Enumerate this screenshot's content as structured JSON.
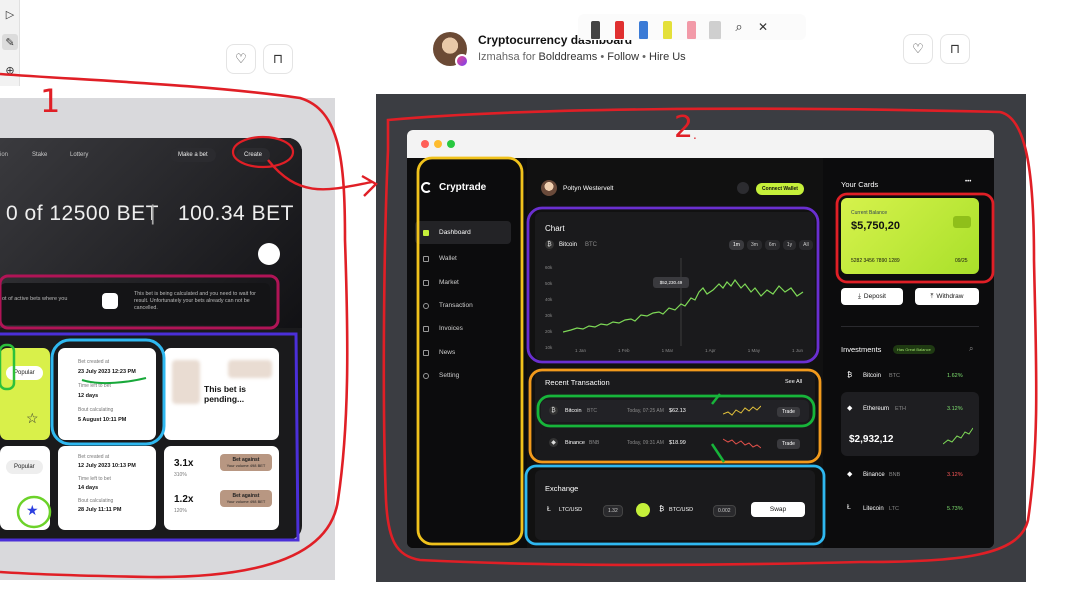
{
  "tools": {
    "select_icon": "▷",
    "pen_icon": "✎",
    "add_icon": "⊕"
  },
  "header": {
    "title": "Cryptocurrency dashboard",
    "author": "Izmahsa",
    "for_label": "for",
    "team": "Bolddreams",
    "follow_label": "Follow",
    "hire_label": "Hire Us",
    "separator": "•",
    "like_icon": "♡",
    "save_icon": "⊓"
  },
  "annotation_toolbar": {
    "pens": [
      "#444444",
      "#e03030",
      "#3b7bd6",
      "#e4e03a",
      "#f29aa8"
    ],
    "lasso_icon": "⌕",
    "close_icon": "✕"
  },
  "annotations": {
    "label_1": "1",
    "label_2": "2",
    "label_2_dot": "."
  },
  "shot1": {
    "nav": [
      "Stake",
      "Lottery"
    ],
    "nav_left_partial": "ion",
    "make_bet": "Make a bet",
    "create": "Create",
    "bet_total": "0 of 12500 BET",
    "divider": "|",
    "bet_value": "100.34 BET",
    "info_left": "ot of active bets where you",
    "info_right": "This bet is being calculated and you need to wait for result. Unfortunately your bets already can not be cancelled.",
    "popular": "Popular",
    "card1": {
      "created_label": "Bet created at",
      "created": "23 July 2023 12:23 PM",
      "time_left_label": "Time left to bet",
      "time_left": "12 days",
      "calc_label": "Bout calculating",
      "calc": "5 August 10:11 PM"
    },
    "pending": "This bet is pending...",
    "card2": {
      "created_label": "Bet created at",
      "created": "12 July 2023 10:13 PM",
      "time_left_label": "Time left to bet",
      "time_left": "14 days",
      "calc_label": "Bout calculating",
      "calc": "28 July 11:11 PM"
    },
    "mult1": "3.1x",
    "mult1_pct": "310%",
    "mult2": "1.2x",
    "mult2_pct": "120%",
    "bet_against": "Bet against",
    "bet_against_sub": "Your volume 498 BET",
    "star_icon": "☆",
    "star_filled_icon": "★"
  },
  "app": {
    "brand": "Cryptrade",
    "menu": [
      "Dashboard",
      "Wallet",
      "Market",
      "Transaction",
      "Invoices",
      "News",
      "Setting"
    ],
    "user": "Poltyn Westervelt",
    "connect_wallet": "Connect Wallet",
    "chart": {
      "title": "Chart",
      "coin": "Bitcoin",
      "symbol": "BTC",
      "ranges": [
        "1m",
        "3m",
        "6m",
        "1y",
        "All"
      ],
      "tooltip": "$52,230.49",
      "y_ticks": [
        "60k",
        "50k",
        "40k",
        "30k",
        "20k",
        "10k"
      ],
      "x_ticks": [
        "1 Jan",
        "1 Feb",
        "1 Mar",
        "1 Apr",
        "1 May",
        "1 Jun"
      ]
    },
    "recent": {
      "title": "Recent Transaction",
      "see_all": "See All",
      "rows": [
        {
          "coin": "Bitcoin",
          "sym": "BTC",
          "time": "Today, 07:25 AM",
          "amount": "$62.13",
          "action": "Trade"
        },
        {
          "coin": "Binance",
          "sym": "BNB",
          "time": "Today, 09:31 AM",
          "amount": "$18.99",
          "action": "Trade"
        }
      ]
    },
    "exchange": {
      "title": "Exchange",
      "from": "LTC/USD",
      "from_val": "1.32",
      "to": "BTC/USD",
      "to_val": "0.002",
      "swap": "Swap"
    },
    "cards": {
      "title": "Your Cards",
      "more": "•••",
      "label": "Current Balance",
      "balance": "$5,750,20",
      "number": "5282 3456 7890 1289",
      "expiry": "09/25",
      "deposit": "Deposit",
      "withdraw": "Withdraw"
    },
    "investments": {
      "title": "Investments",
      "badge": "Has Great Balance",
      "items": [
        {
          "coin": "Bitcoin",
          "sym": "BTC",
          "change": "1.62%",
          "color": "#7ee06f"
        },
        {
          "coin": "Ethereum",
          "sym": "ETH",
          "change": "3.12%",
          "color": "#7ee06f",
          "value": "$2,932,12"
        },
        {
          "coin": "Binance",
          "sym": "BNB",
          "change": "3.12%",
          "color": "#ff5a5a"
        },
        {
          "coin": "Litecoin",
          "sym": "LTC",
          "change": "5.73%",
          "color": "#7ee06f"
        }
      ]
    }
  }
}
